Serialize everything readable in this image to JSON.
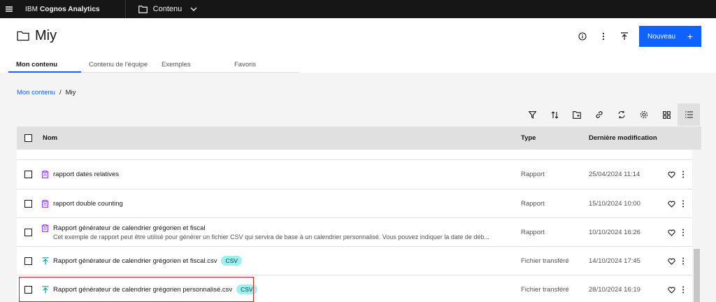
{
  "topbar": {
    "brand_prefix": "IBM",
    "brand_name": "Cognos Analytics",
    "location": "Contenu"
  },
  "header": {
    "title": "Miy",
    "new_button_label": "Nouveau",
    "new_button_icon": "+"
  },
  "tabs": [
    {
      "label": "Mon contenu",
      "active": true
    },
    {
      "label": "Contenu de l'équipe",
      "active": false
    },
    {
      "label": "Exemples",
      "active": false
    },
    {
      "label": "Favoris",
      "active": false
    }
  ],
  "breadcrumb": {
    "root": "Mon contenu",
    "separator": "/",
    "current": "Miy"
  },
  "table": {
    "columns": {
      "name": "Nom",
      "type": "Type",
      "modified": "Dernière modification"
    },
    "rows": [
      {
        "name": "rapport dates relatives",
        "icon": "report-icon",
        "type": "Rapport",
        "modified": "25/04/2024 11:14"
      },
      {
        "name": "rapport double counting",
        "icon": "report-icon",
        "type": "Rapport",
        "modified": "15/10/2024 10:00"
      },
      {
        "name": "Rapport générateur de calendrier grégorien et fiscal",
        "description": "Cet exemple de rapport peut être utilisé pour générer un fichier CSV qui servira de base à un calendrier personnalisé. Vous pouvez indiquer la date de déb...",
        "icon": "report-icon",
        "type": "Rapport",
        "modified": "10/10/2024 16:26"
      },
      {
        "name": "Rapport générateur de calendrier grégorien et fiscal.csv",
        "tag": "CSV",
        "icon": "upload-icon",
        "type": "Fichier transféré",
        "modified": "14/10/2024 17:45"
      },
      {
        "name": "Rapport générateur de calendrier grégorien personnalisé.csv",
        "tag": "CSV",
        "icon": "upload-icon",
        "type": "Fichier transféré",
        "modified": "28/10/2024 16:19"
      }
    ]
  },
  "colors": {
    "accent": "#0f62fe",
    "topbar": "#161616",
    "report_icon": "#8a3ffc",
    "upload_icon": "#009d9a",
    "csv_tag_bg": "#9ef0f0",
    "highlight": "#da1e28"
  }
}
